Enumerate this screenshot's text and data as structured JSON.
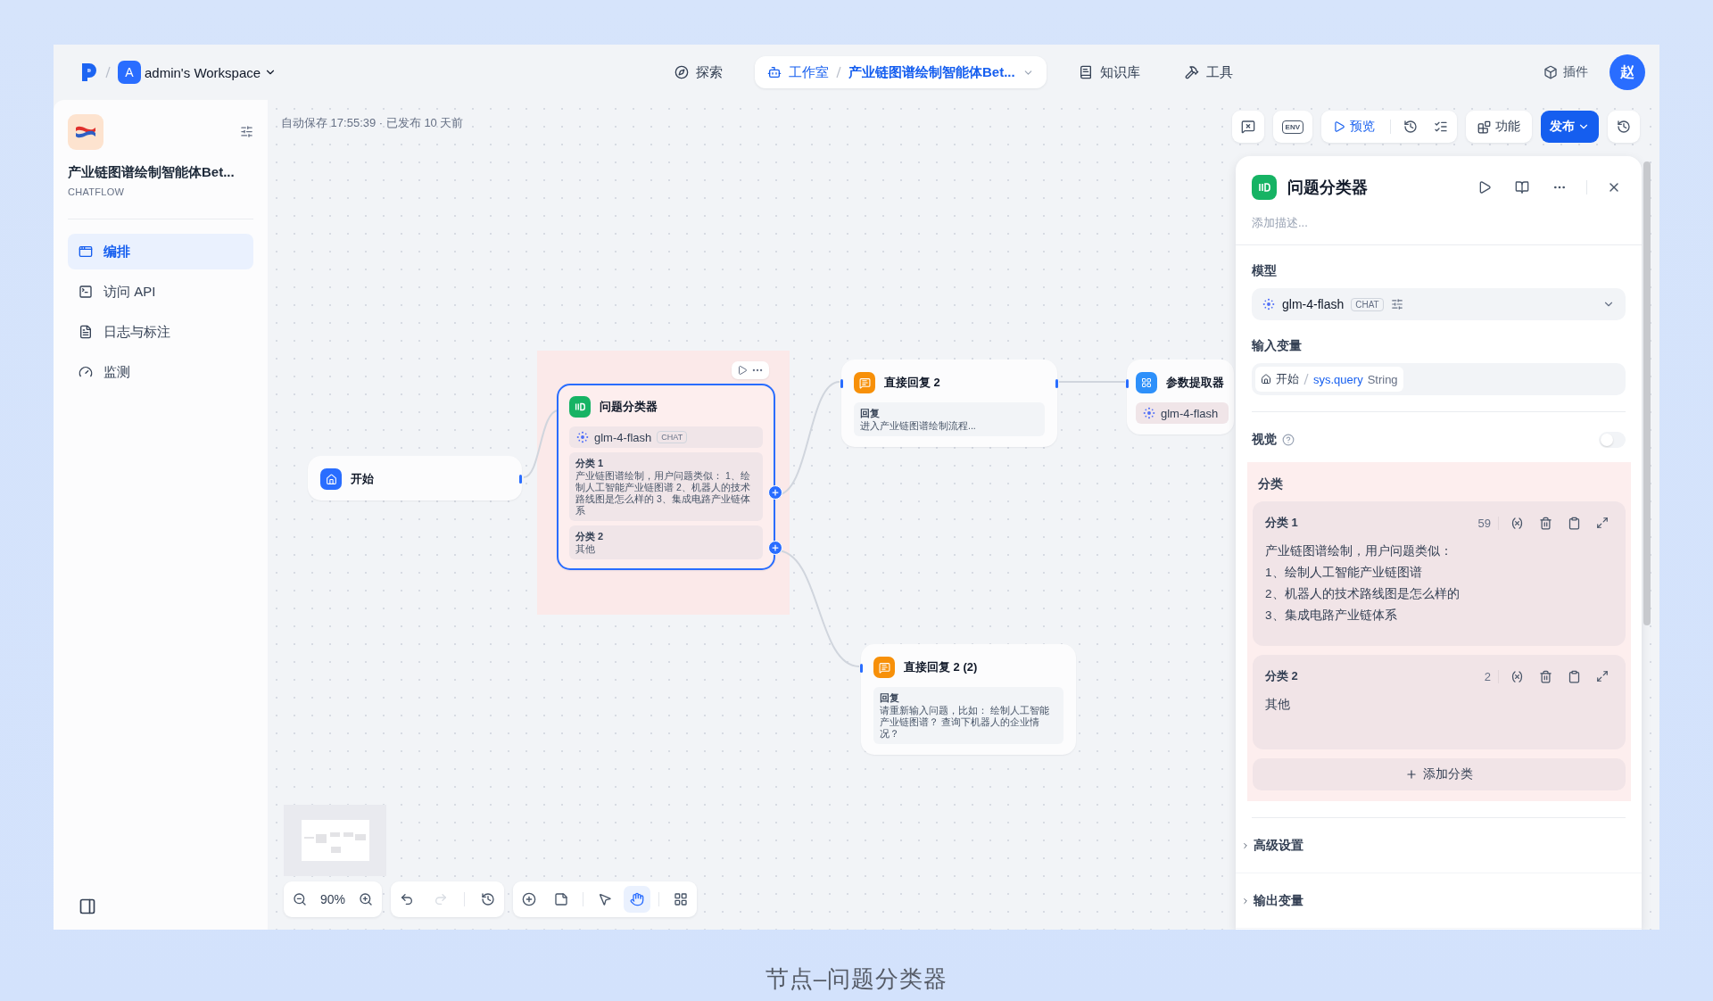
{
  "topbar": {
    "workspace": {
      "initial": "A",
      "name": "admin's Workspace"
    },
    "nav": [
      {
        "kind": "explore",
        "label": "探索",
        "selected": false
      },
      {
        "kind": "studio",
        "label": "工作室",
        "selected": true,
        "app": "产业链图谱绘制智能体Bet..."
      },
      {
        "kind": "knowledge",
        "label": "知识库",
        "selected": false
      },
      {
        "kind": "tools",
        "label": "工具",
        "selected": false
      }
    ],
    "plugins": "插件",
    "user": "赵"
  },
  "sidebar": {
    "app_name": "产业链图谱绘制智能体Bet...",
    "app_type": "CHATFLOW",
    "items": [
      {
        "kind": "orchestrate",
        "label": "编排",
        "selected": true
      },
      {
        "kind": "api",
        "label": "访问 API",
        "selected": false
      },
      {
        "kind": "logs",
        "label": "日志与标注",
        "selected": false
      },
      {
        "kind": "monitor",
        "label": "监测",
        "selected": false
      }
    ]
  },
  "canvas": {
    "status": "自动保存 17:55:39 · 已发布 10 天前",
    "toolbar": {
      "env": "ENV",
      "preview": "预览",
      "features": "功能",
      "publish": "发布"
    },
    "nodes": [
      {
        "kind": "start",
        "title": "开始",
        "selected": false
      },
      {
        "kind": "classifier",
        "title": "问题分类器",
        "selected": true,
        "model": "glm-4-flash",
        "mode": "CHAT",
        "classes": [
          {
            "label": "分类 1",
            "text": "产业链图谱绘制，用户问题类似： 1、绘制人工智能产业链图谱 2、机器人的技术路线图是怎么样的 3、集成电路产业链体系"
          },
          {
            "label": "分类 2",
            "text": "其他"
          }
        ]
      },
      {
        "kind": "answer",
        "title": "直接回复 2",
        "selected": false,
        "reply_label": "回复",
        "text": "进入产业链图谱绘制流程..."
      },
      {
        "kind": "extractor",
        "title": "参数提取器",
        "selected": false,
        "model": "glm-4-flash"
      },
      {
        "kind": "answer",
        "title": "直接回复 2 (2)",
        "selected": false,
        "reply_label": "回复",
        "text": "请重新输入问题，比如： 绘制人工智能产业链图谱？ 查询下机器人的企业情况？"
      }
    ],
    "zoom": "90%",
    "history": [
      {
        "kind": "undo",
        "disabled": false
      },
      {
        "kind": "redo",
        "disabled": true
      },
      {
        "kind": "history",
        "disabled": false
      }
    ],
    "tools": [
      {
        "kind": "add",
        "selected": false
      },
      {
        "kind": "note",
        "selected": false
      },
      {
        "kind": "pointer",
        "selected": false
      },
      {
        "kind": "hand",
        "selected": true
      }
    ]
  },
  "panel": {
    "title": "问题分类器",
    "description_placeholder": "添加描述...",
    "model_label": "模型",
    "model": {
      "name": "glm-4-flash",
      "mode": "CHAT"
    },
    "input_label": "输入变量",
    "input_var": {
      "node": "开始",
      "variable": "sys.query",
      "type": "String"
    },
    "vision": {
      "label": "视觉",
      "on": false
    },
    "classes_label": "分类",
    "classes": [
      {
        "label": "分类 1",
        "count": "59",
        "lines": [
          "产业链图谱绘制，用户问题类似：",
          "1、绘制人工智能产业链图谱",
          "2、机器人的技术路线图是怎么样的",
          "3、集成电路产业链体系"
        ]
      },
      {
        "label": "分类 2",
        "count": "2",
        "lines": [
          "其他"
        ]
      }
    ],
    "add_class": "添加分类",
    "sections": [
      {
        "label": "高级设置",
        "expanded": false
      },
      {
        "label": "输出变量",
        "expanded": false
      }
    ]
  },
  "caption": "节点–问题分类器"
}
